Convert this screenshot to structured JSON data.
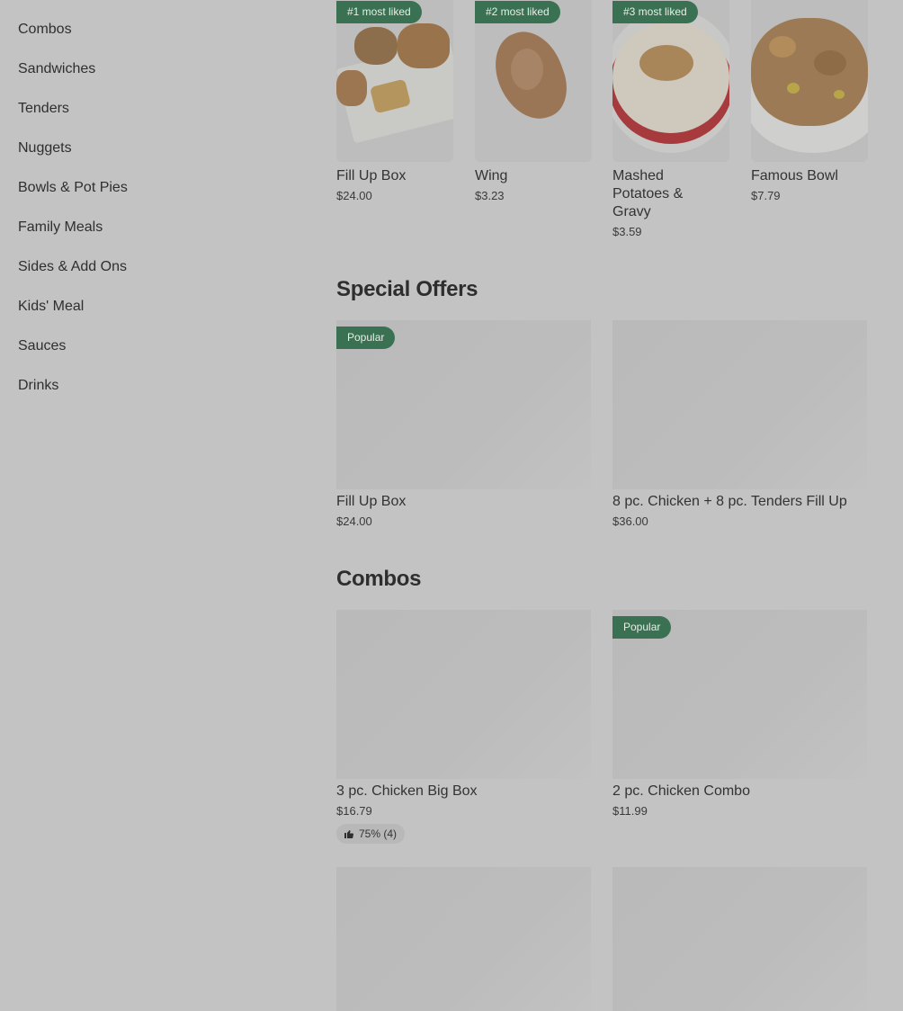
{
  "sidebar": {
    "items": [
      {
        "label": "Combos"
      },
      {
        "label": "Sandwiches"
      },
      {
        "label": "Tenders"
      },
      {
        "label": "Nuggets"
      },
      {
        "label": "Bowls & Pot Pies"
      },
      {
        "label": "Family Meals"
      },
      {
        "label": "Sides & Add Ons"
      },
      {
        "label": "Kids' Meal"
      },
      {
        "label": "Sauces"
      },
      {
        "label": "Drinks"
      }
    ]
  },
  "most_liked": [
    {
      "badge": "#1 most liked",
      "name": "Fill Up Box",
      "price": "$24.00"
    },
    {
      "badge": "#2 most liked",
      "name": "Wing",
      "price": "$3.23"
    },
    {
      "badge": "#3 most liked",
      "name": "Mashed Potatoes & Gravy",
      "price": "$3.59"
    },
    {
      "badge": "",
      "name": "Famous Bowl",
      "price": "$7.79"
    }
  ],
  "special_offers": {
    "title": "Special Offers",
    "items": [
      {
        "badge": "Popular",
        "name": "Fill Up Box",
        "price": "$24.00"
      },
      {
        "badge": "",
        "name": "8 pc. Chicken + 8 pc. Tenders Fill Up",
        "price": "$36.00"
      }
    ]
  },
  "combos": {
    "title": "Combos",
    "items": [
      {
        "badge": "",
        "name": "3 pc. Chicken Big Box",
        "price": "$16.79",
        "rating": "75% (4)"
      },
      {
        "badge": "Popular",
        "name": "2 pc. Chicken Combo",
        "price": "$11.99"
      }
    ]
  },
  "colors": {
    "overlay_bg": "#c3c3c3",
    "badge_green": "#3a7152"
  }
}
